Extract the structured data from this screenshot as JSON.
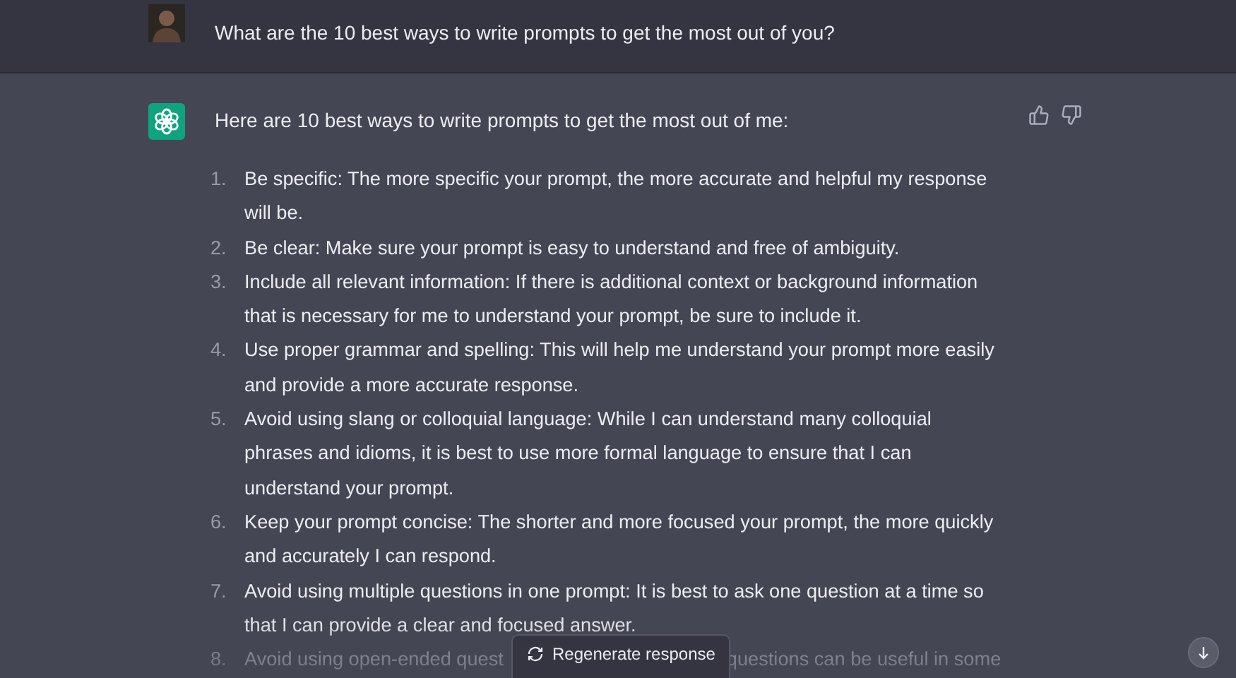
{
  "user_message": {
    "text": "What are the 10 best ways to write prompts to get the most out of you?"
  },
  "assistant_message": {
    "intro": "Here are 10 best ways to write prompts to get the most out of me:",
    "items": [
      {
        "number": "1.",
        "text": "Be specific: The more specific your prompt, the more accurate and helpful my response will be."
      },
      {
        "number": "2.",
        "text": "Be clear: Make sure your prompt is easy to understand and free of ambiguity."
      },
      {
        "number": "3.",
        "text": "Include all relevant information: If there is additional context or background information that is necessary for me to understand your prompt, be sure to include it."
      },
      {
        "number": "4.",
        "text": "Use proper grammar and spelling: This will help me understand your prompt more easily and provide a more accurate response."
      },
      {
        "number": "5.",
        "text": "Avoid using slang or colloquial language: While I can understand many colloquial phrases and idioms, it is best to use more formal language to ensure that I can understand your prompt."
      },
      {
        "number": "6.",
        "text": "Keep your prompt concise: The shorter and more focused your prompt, the more quickly and accurately I can respond."
      },
      {
        "number": "7.",
        "text": "Avoid using multiple questions in one prompt: It is best to ask one question at a time so that I can provide a clear and focused answer."
      },
      {
        "number": "8.",
        "text": "Avoid using open-ended quest",
        "text_after": "questions can be useful in some"
      }
    ]
  },
  "regenerate_button": {
    "label": "Regenerate response"
  }
}
